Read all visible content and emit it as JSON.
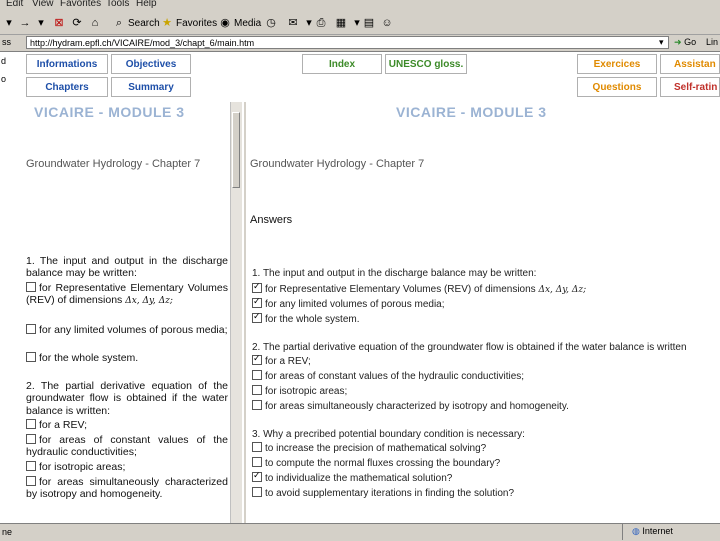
{
  "menubar": {
    "items": [
      "Edit",
      "View",
      "Favorites",
      "Tools",
      "Help"
    ]
  },
  "toolbar": {
    "search_label": "Search",
    "favorites_label": "Favorites",
    "media_label": "Media"
  },
  "address": {
    "label": "ss",
    "url": "http://hydram.epfl.ch/VICAIRE/mod_3/chapt_6/main.htm",
    "go_label": "Go",
    "links_label": "Lin"
  },
  "nav": {
    "informations": "Informations",
    "objectives": "Objectives",
    "chapters": "Chapters",
    "summary": "Summary",
    "index": "Index",
    "unesco": "UNESCO gloss.",
    "exercices": "Exercices",
    "assistance": "Assistan",
    "questions": "Questions",
    "selfrating": "Self-ratin"
  },
  "left_frame": {
    "module_title": "VICAIRE - MODULE 3",
    "chapter_title": "Groundwater Hydrology - Chapter 7",
    "q1": "1. The input and output in the discharge balance may be written:",
    "q1_opt1a": "for Representative Elementary Volumes (REV) of dimensions",
    "q1_opt1_math": "Δx, Δy,",
    "q1_opt1b": "Δz;",
    "q1_opt2": "for any limited volumes of porous media;",
    "q1_opt3": "for the whole system.",
    "q2": "2. The partial derivative equation of the groundwater flow is obtained if the water balance is written:",
    "q2_opt1": "for a REV;",
    "q2_opt2": "for areas of constant values of the hydraulic conductivities;",
    "q2_opt3": "for isotropic areas;",
    "q2_opt4": "for areas simultaneously characterized by isotropy and homogeneity."
  },
  "right_frame": {
    "module_title": "VICAIRE - MODULE 3",
    "chapter_title": "Groundwater Hydrology - Chapter 7",
    "answers_title": "Answers",
    "q1": "1. The input and output in the discharge balance may be written:",
    "q1_opt1": "for Representative Elementary Volumes (REV) of dimensions",
    "q1_opt1_math": "Δx, Δy, Δz;",
    "q1_opt2": "for any limited volumes of porous media;",
    "q1_opt3": "for the whole system.",
    "q2": "2. The partial derivative equation of the groundwater flow is obtained if the water balance is written",
    "q2_opt1": "for a REV;",
    "q2_opt2": "for areas of constant values of the hydraulic conductivities;",
    "q2_opt3": "for isotropic areas;",
    "q2_opt4": "for areas simultaneously characterized by isotropy and homogeneity.",
    "q3": "3. Why a precribed potential boundary condition is necessary:",
    "q3_opt1": "to increase the precision of mathematical solving?",
    "q3_opt2": "to compute the normal fluxes crossing the boundary?",
    "q3_opt3": "to individualize the mathematical solution?",
    "q3_opt4": "to avoid supplementary iterations in finding the solution?"
  },
  "status": {
    "left": "ne",
    "zone": "Internet"
  },
  "colors": {
    "nav_blue": "#1e4fa8",
    "nav_orange": "#e08a00",
    "nav_green": "#3c8a28",
    "nav_red": "#c0302a",
    "module_title": "#9bb3d3"
  }
}
